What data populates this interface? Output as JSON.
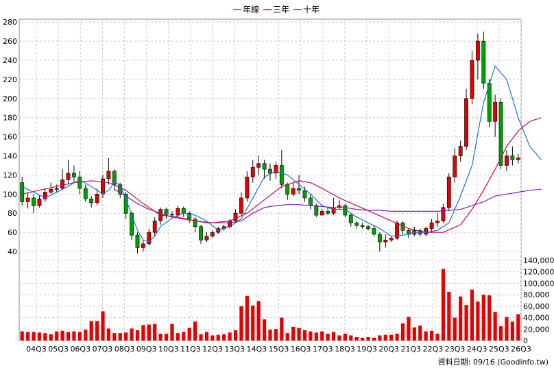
{
  "chart_data": {
    "type": "candlestick",
    "legend": [
      {
        "name": "年線",
        "color": "#1f6fd0"
      },
      {
        "name": "三年",
        "color": "#d6004f"
      },
      {
        "name": "十年",
        "color": "#7a1fb8"
      }
    ],
    "price_axis": {
      "ticks": [
        40,
        60,
        80,
        100,
        120,
        140,
        160,
        180,
        200,
        220,
        240,
        260,
        280
      ]
    },
    "volume_axis": {
      "ticks": [
        "0",
        "20,000",
        "40,000",
        "60,000",
        "80,000",
        "100,000",
        "120,000",
        "140,000"
      ]
    },
    "x_labels": [
      "04Q3",
      "05Q3",
      "06Q3",
      "07Q3",
      "08Q3",
      "09Q3",
      "10Q3",
      "11Q3",
      "12Q3",
      "13Q3",
      "14Q3",
      "15Q3",
      "16Q3",
      "17Q3",
      "18Q3",
      "19Q3",
      "20Q3",
      "21Q3",
      "22Q3",
      "23Q3",
      "24Q3",
      "25Q3",
      "26Q3"
    ],
    "source_label": "資料日期: 09/16 (Goodinfo.tw)",
    "colors": {
      "up": "#e60000",
      "down": "#00a000",
      "volume": "#e60000"
    },
    "candles": [
      [
        112,
        92,
        118,
        88
      ],
      [
        92,
        96,
        102,
        85
      ],
      [
        96,
        88,
        100,
        80
      ],
      [
        88,
        95,
        99,
        86
      ],
      [
        95,
        102,
        106,
        92
      ],
      [
        102,
        105,
        112,
        100
      ],
      [
        105,
        106,
        110,
        102
      ],
      [
        106,
        115,
        126,
        104
      ],
      [
        115,
        122,
        136,
        110
      ],
      [
        122,
        118,
        130,
        112
      ],
      [
        118,
        106,
        124,
        100
      ],
      [
        106,
        95,
        110,
        92
      ],
      [
        95,
        91,
        98,
        86
      ],
      [
        91,
        100,
        106,
        88
      ],
      [
        100,
        116,
        120,
        96
      ],
      [
        116,
        124,
        138,
        110
      ],
      [
        124,
        110,
        126,
        104
      ],
      [
        110,
        100,
        112,
        96
      ],
      [
        100,
        80,
        102,
        74
      ],
      [
        80,
        57,
        82,
        52
      ],
      [
        57,
        44,
        60,
        38
      ],
      [
        44,
        48,
        52,
        40
      ],
      [
        48,
        60,
        64,
        46
      ],
      [
        60,
        72,
        76,
        56
      ],
      [
        72,
        84,
        86,
        68
      ],
      [
        84,
        79,
        86,
        74
      ],
      [
        79,
        78,
        82,
        74
      ],
      [
        78,
        85,
        88,
        76
      ],
      [
        85,
        80,
        87,
        76
      ],
      [
        80,
        74,
        82,
        70
      ],
      [
        74,
        66,
        76,
        60
      ],
      [
        66,
        52,
        68,
        48
      ],
      [
        52,
        56,
        60,
        50
      ],
      [
        56,
        60,
        62,
        54
      ],
      [
        60,
        64,
        66,
        58
      ],
      [
        64,
        66,
        68,
        62
      ],
      [
        66,
        72,
        74,
        64
      ],
      [
        72,
        80,
        84,
        70
      ],
      [
        80,
        96,
        102,
        78
      ],
      [
        96,
        118,
        124,
        92
      ],
      [
        118,
        128,
        136,
        112
      ],
      [
        128,
        132,
        140,
        120
      ],
      [
        132,
        126,
        136,
        116
      ],
      [
        126,
        122,
        132,
        114
      ],
      [
        122,
        130,
        134,
        116
      ],
      [
        130,
        110,
        146,
        106
      ],
      [
        110,
        100,
        112,
        94
      ],
      [
        100,
        106,
        112,
        98
      ],
      [
        106,
        104,
        120,
        100
      ],
      [
        104,
        96,
        108,
        92
      ],
      [
        96,
        88,
        100,
        84
      ],
      [
        88,
        78,
        90,
        76
      ],
      [
        78,
        82,
        84,
        80
      ],
      [
        82,
        80,
        86,
        78
      ],
      [
        80,
        86,
        96,
        78
      ],
      [
        86,
        88,
        94,
        84
      ],
      [
        88,
        78,
        90,
        76
      ],
      [
        78,
        70,
        80,
        66
      ],
      [
        70,
        67,
        72,
        64
      ],
      [
        67,
        66,
        70,
        64
      ],
      [
        66,
        64,
        68,
        62
      ],
      [
        64,
        58,
        68,
        56
      ],
      [
        58,
        50,
        60,
        40
      ],
      [
        50,
        52,
        58,
        44
      ],
      [
        52,
        54,
        56,
        50
      ],
      [
        54,
        70,
        72,
        52
      ],
      [
        70,
        62,
        72,
        58
      ],
      [
        62,
        58,
        64,
        54
      ],
      [
        58,
        62,
        66,
        56
      ],
      [
        62,
        58,
        64,
        56
      ],
      [
        58,
        64,
        66,
        56
      ],
      [
        64,
        70,
        74,
        60
      ],
      [
        70,
        72,
        80,
        66
      ],
      [
        72,
        86,
        90,
        70
      ],
      [
        86,
        118,
        122,
        82
      ],
      [
        118,
        140,
        148,
        112
      ],
      [
        140,
        150,
        156,
        134
      ],
      [
        150,
        200,
        210,
        146
      ],
      [
        200,
        240,
        250,
        194
      ],
      [
        240,
        260,
        268,
        220
      ],
      [
        260,
        216,
        270,
        210
      ],
      [
        216,
        176,
        220,
        170
      ],
      [
        176,
        196,
        204,
        160
      ],
      [
        196,
        130,
        200,
        126
      ],
      [
        130,
        140,
        146,
        124
      ],
      [
        140,
        136,
        150,
        130
      ],
      [
        136,
        138,
        142,
        132
      ]
    ],
    "volumes": [
      16000,
      15000,
      15000,
      14000,
      13000,
      11000,
      16000,
      17000,
      15000,
      16000,
      15000,
      19000,
      34000,
      34000,
      51000,
      21000,
      13000,
      13000,
      14000,
      21000,
      18000,
      27000,
      28000,
      29000,
      12000,
      12000,
      29000,
      13000,
      15000,
      22000,
      33000,
      11000,
      15000,
      9000,
      10000,
      11000,
      14000,
      18000,
      60000,
      78000,
      61000,
      69000,
      37000,
      19000,
      20000,
      40000,
      13000,
      24000,
      22000,
      18000,
      16000,
      14000,
      16000,
      12000,
      15000,
      9000,
      12000,
      9000,
      6000,
      5000,
      6000,
      5000,
      9000,
      10000,
      10000,
      12000,
      30000,
      41000,
      23000,
      26000,
      16000,
      17000,
      12000,
      125000,
      85000,
      40000,
      77000,
      62000,
      89000,
      68000,
      80000,
      79000,
      50000,
      25000,
      41000,
      33000,
      46000,
      37000,
      31000,
      38000,
      25000
    ],
    "ma_yearly": [
      [
        0,
        108
      ],
      [
        4,
        96
      ],
      [
        7,
        105
      ],
      [
        10,
        115
      ],
      [
        12,
        108
      ],
      [
        14,
        100
      ],
      [
        15,
        104
      ],
      [
        16,
        112
      ],
      [
        17,
        110
      ],
      [
        18,
        95
      ],
      [
        19,
        78
      ],
      [
        20,
        62
      ],
      [
        21,
        52
      ],
      [
        22,
        50
      ],
      [
        23,
        56
      ],
      [
        24,
        66
      ],
      [
        26,
        75
      ],
      [
        28,
        80
      ],
      [
        30,
        78
      ],
      [
        32,
        72
      ],
      [
        34,
        62
      ],
      [
        36,
        66
      ],
      [
        38,
        74
      ],
      [
        40,
        96
      ],
      [
        42,
        118
      ],
      [
        44,
        124
      ],
      [
        46,
        120
      ],
      [
        48,
        110
      ],
      [
        50,
        100
      ],
      [
        52,
        88
      ],
      [
        54,
        84
      ],
      [
        56,
        84
      ],
      [
        58,
        76
      ],
      [
        60,
        70
      ],
      [
        62,
        64
      ],
      [
        64,
        56
      ],
      [
        66,
        57
      ],
      [
        68,
        60
      ],
      [
        70,
        60
      ],
      [
        72,
        62
      ],
      [
        74,
        70
      ],
      [
        76,
        98
      ],
      [
        78,
        130
      ],
      [
        80,
        196
      ],
      [
        82,
        234
      ],
      [
        84,
        220
      ],
      [
        86,
        180
      ],
      [
        88,
        150
      ],
      [
        90,
        136
      ]
    ],
    "ma_3year": [
      [
        0,
        100
      ],
      [
        3,
        104
      ],
      [
        6,
        108
      ],
      [
        9,
        112
      ],
      [
        12,
        114
      ],
      [
        15,
        112
      ],
      [
        18,
        104
      ],
      [
        21,
        90
      ],
      [
        24,
        78
      ],
      [
        27,
        76
      ],
      [
        30,
        72
      ],
      [
        33,
        70
      ],
      [
        36,
        72
      ],
      [
        39,
        80
      ],
      [
        42,
        94
      ],
      [
        45,
        108
      ],
      [
        48,
        114
      ],
      [
        50,
        112
      ],
      [
        52,
        106
      ],
      [
        55,
        96
      ],
      [
        58,
        88
      ],
      [
        61,
        80
      ],
      [
        64,
        72
      ],
      [
        67,
        64
      ],
      [
        70,
        60
      ],
      [
        73,
        60
      ],
      [
        76,
        68
      ],
      [
        78,
        84
      ],
      [
        80,
        104
      ],
      [
        82,
        126
      ],
      [
        84,
        150
      ],
      [
        86,
        166
      ],
      [
        88,
        176
      ],
      [
        90,
        180
      ]
    ],
    "ma_10year": [
      [
        16,
        105
      ],
      [
        18,
        98
      ],
      [
        20,
        90
      ],
      [
        22,
        84
      ],
      [
        24,
        80
      ],
      [
        26,
        76
      ],
      [
        28,
        74
      ],
      [
        30,
        72
      ],
      [
        32,
        70
      ],
      [
        34,
        70
      ],
      [
        36,
        70
      ],
      [
        38,
        72
      ],
      [
        40,
        80
      ],
      [
        42,
        86
      ],
      [
        44,
        88
      ],
      [
        46,
        89
      ],
      [
        48,
        89
      ],
      [
        50,
        88
      ],
      [
        52,
        87
      ],
      [
        54,
        86
      ],
      [
        56,
        86
      ],
      [
        58,
        84
      ],
      [
        60,
        83
      ],
      [
        62,
        83
      ],
      [
        64,
        82
      ],
      [
        66,
        82
      ],
      [
        68,
        82
      ],
      [
        70,
        82
      ],
      [
        72,
        82
      ],
      [
        74,
        83
      ],
      [
        76,
        84
      ],
      [
        78,
        88
      ],
      [
        80,
        92
      ],
      [
        82,
        98
      ],
      [
        84,
        100
      ],
      [
        86,
        102
      ],
      [
        88,
        104
      ],
      [
        90,
        105
      ]
    ]
  }
}
